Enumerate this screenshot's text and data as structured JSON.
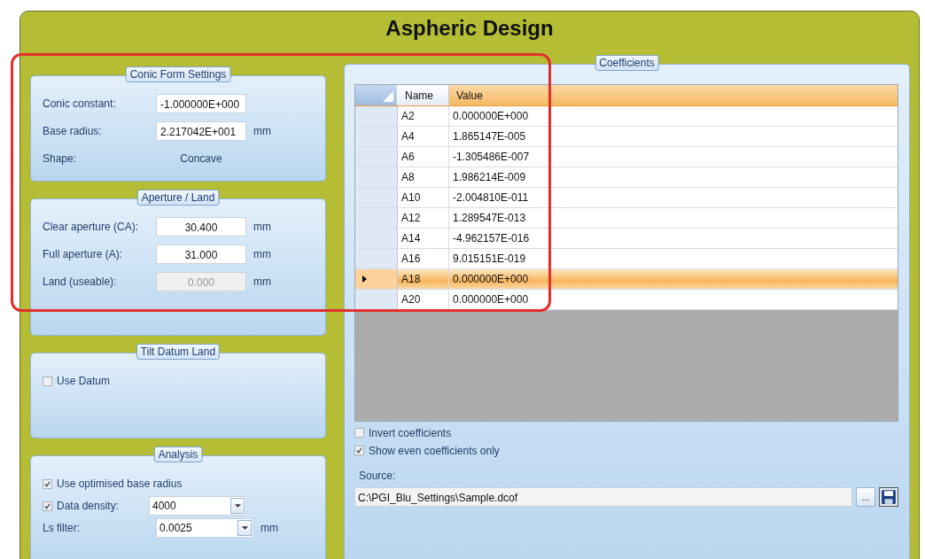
{
  "title": "Aspheric Design",
  "groups": [
    {
      "title": "Conic Form Settings",
      "rows": [
        {
          "kind": "input",
          "label": "Conic constant:",
          "value": "-1.000000E+000",
          "disabled": false
        },
        {
          "kind": "input",
          "label": "Base radius:",
          "value": "2.217042E+001",
          "unit": "mm",
          "disabled": false
        },
        {
          "kind": "text",
          "label": "Shape:",
          "value": "Concave"
        }
      ]
    },
    {
      "title": "Aperture / Land",
      "rows": [
        {
          "kind": "input",
          "label": "Clear aperture (CA):",
          "value": "30.400",
          "unit": "mm",
          "disabled": false
        },
        {
          "kind": "input",
          "label": "Full aperture (A):",
          "value": "31.000",
          "unit": "mm",
          "disabled": false
        },
        {
          "kind": "input",
          "label": "Land (useable):",
          "value": "0.000",
          "unit": "mm",
          "disabled": true
        }
      ]
    },
    {
      "title": "Tilt Datum Land",
      "rows": [
        {
          "kind": "checkbox",
          "label": "Use Datum",
          "checked": false
        }
      ]
    },
    {
      "title": "Analysis",
      "rows": [
        {
          "kind": "checkbox",
          "label": "Use optimised base radius",
          "checked": true
        },
        {
          "kind": "checkcombo",
          "label": "Data density:",
          "checked": true,
          "value": "4000"
        },
        {
          "kind": "combo",
          "label": "Ls  filter:",
          "value": "0.0025",
          "unit": "mm"
        }
      ]
    }
  ],
  "coefficients": {
    "title": "Coefficients",
    "columns": [
      "Name",
      "Value"
    ],
    "rows": [
      {
        "name": "A2",
        "value": "0.000000E+000",
        "selected": false
      },
      {
        "name": "A4",
        "value": "1.865147E-005",
        "selected": false
      },
      {
        "name": "A6",
        "value": "-1.305486E-007",
        "selected": false
      },
      {
        "name": "A8",
        "value": "1.986214E-009",
        "selected": false
      },
      {
        "name": "A10",
        "value": "-2.004810E-011",
        "selected": false
      },
      {
        "name": "A12",
        "value": "1.289547E-013",
        "selected": false
      },
      {
        "name": "A14",
        "value": "-4.962157E-016",
        "selected": false
      },
      {
        "name": "A16",
        "value": "9.015151E-019",
        "selected": false
      },
      {
        "name": "A18",
        "value": "0.000000E+000",
        "selected": true
      },
      {
        "name": "A20",
        "value": "0.000000E+000",
        "selected": false
      }
    ],
    "options": [
      {
        "label": "Invert coefficients",
        "checked": false
      },
      {
        "label": "Show even coefficients only",
        "checked": true
      }
    ],
    "source": {
      "label": "Source:",
      "value": "C:\\PGI_Blu_Settings\\Sample.dcof",
      "browse": "..."
    }
  }
}
